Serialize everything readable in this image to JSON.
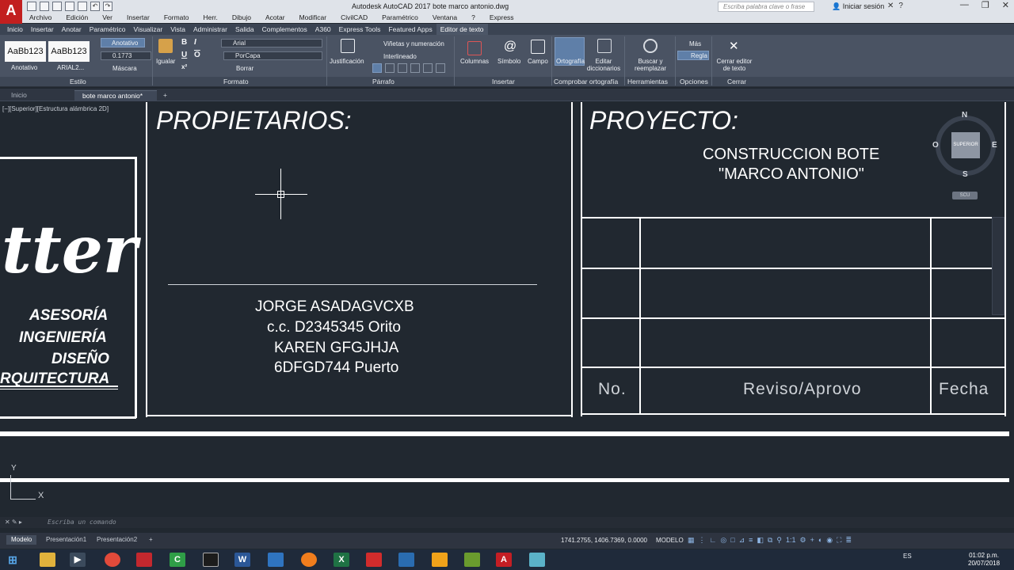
{
  "app": {
    "logo": "A",
    "title": "Autodesk AutoCAD 2017    bote marco antonio.dwg",
    "search_placeholder": "Escriba palabra clave o frase",
    "signin": "Iniciar sesión"
  },
  "menu": [
    "Archivo",
    "Edición",
    "Ver",
    "Insertar",
    "Formato",
    "Herr.",
    "Dibujo",
    "Acotar",
    "Modificar",
    "CivilCAD",
    "Paramétrico",
    "Ventana",
    "?",
    "Express"
  ],
  "ribbon_tabs": [
    "Inicio",
    "Insertar",
    "Anotar",
    "Paramétrico",
    "Visualizar",
    "Vista",
    "Administrar",
    "Salida",
    "Complementos",
    "A360",
    "Express Tools",
    "Featured Apps",
    "Editor de texto"
  ],
  "ribbon": {
    "style_sample_1": "AaBb123",
    "style_sample_2": "AaBb123",
    "style_name_1": "Anotativo",
    "style_name_2": "ARIAL2...",
    "anotativo_btn": "Anotativo",
    "height_value": "0.1773",
    "mascara": "Máscara",
    "igualar": "Igualar",
    "font_value": "Arial",
    "color_value": "PorCapa",
    "borrar": "Borrar",
    "justificacion": "Justificación",
    "vinetas": "Viñetas y numeración",
    "interlineado": "Interlineado",
    "columnas": "Columnas",
    "simbolo": "Símbolo",
    "campo": "Campo",
    "ortografia": "Ortografía",
    "editar_dicc": "Editar diccionarios",
    "buscar": "Buscar y reemplazar",
    "mas": "Más",
    "regla": "Regla",
    "cerrar": "Cerrar editor de texto",
    "panels": {
      "estilo": "Estilo",
      "formato": "Formato",
      "parrafo": "Párrafo",
      "insertar": "Insertar",
      "comprobar": "Comprobar ortografía",
      "herramientas": "Herramientas",
      "opciones": "Opciones",
      "cerrar": "Cerrar"
    }
  },
  "doc_tabs": {
    "inicio": "Inicio",
    "active": "bote marco antonio*"
  },
  "viewport_label": "[−][Superior][Estructura alámbrica 2D]",
  "drawing": {
    "logo_text": "tter",
    "firm_lines": [
      "ASESORÍA",
      "INGENIERÍA",
      "DISEÑO",
      "RQUITECTURA"
    ],
    "propietarios_title": "PROPIETARIOS:",
    "owners": [
      "JORGE ASADAGVCXB",
      "c.c. D2345345  Orito",
      "KAREN GFGJHJA",
      "6DFGD744 Puerto"
    ],
    "proyecto_title": "PROYECTO:",
    "project_name_1": "CONSTRUCCION BOTE",
    "project_name_2": "\"MARCO ANTONIO\"",
    "rev_no": "No.",
    "rev_reviso": "Reviso/Aprovo",
    "rev_fecha": "Fecha"
  },
  "viewcube": {
    "n": "N",
    "s": "S",
    "e": "E",
    "o": "O",
    "center": "SUPERIOR",
    "scu": "SCU"
  },
  "ucs": {
    "x": "X",
    "y": "Y"
  },
  "command": {
    "placeholder": "Escriba un comando"
  },
  "layout_tabs": [
    "Modelo",
    "Presentación1",
    "Presentación2"
  ],
  "status": {
    "coords": "1741.2755, 1406.7369, 0.0000",
    "modelo": "MODELO",
    "scale": "1:1"
  },
  "taskbar": {
    "lang": "ES",
    "time": "01:02 p.m.",
    "date": "20/07/2018"
  }
}
